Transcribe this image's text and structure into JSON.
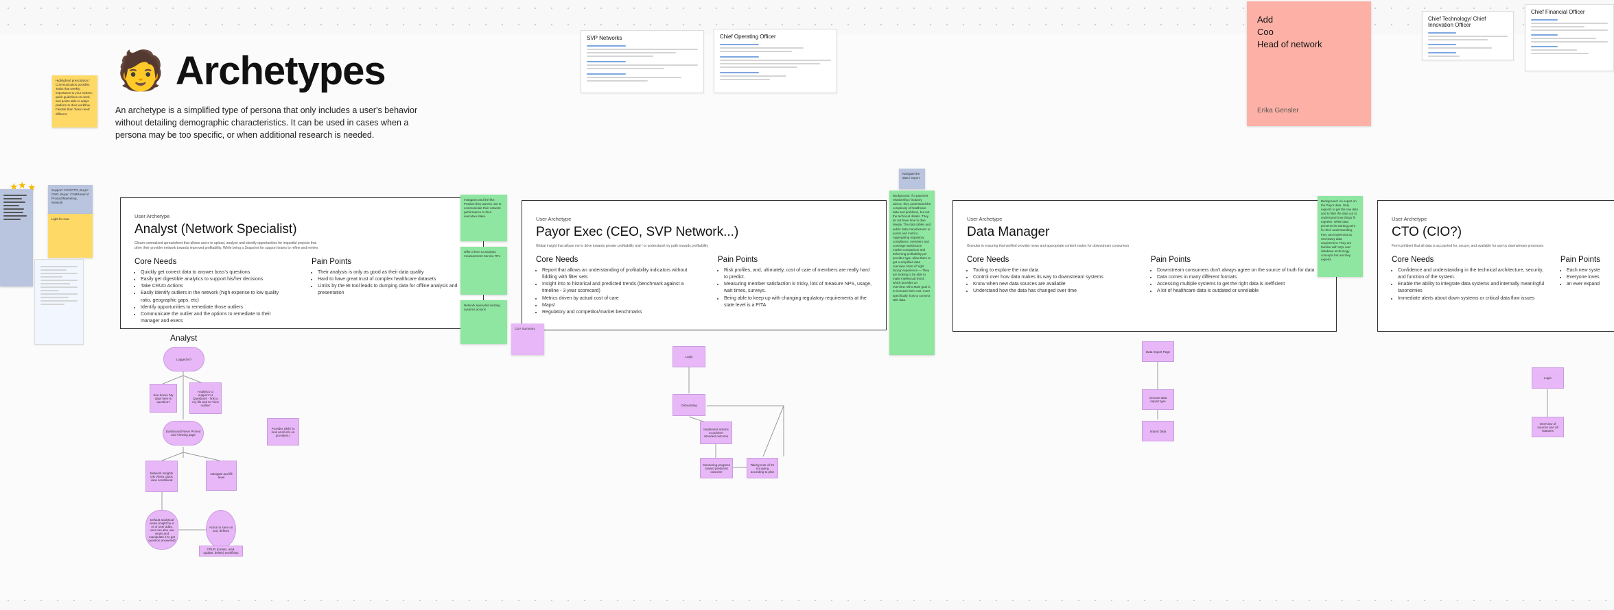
{
  "header": {
    "emoji": "🧑",
    "title": "Archetypes",
    "intro": "An archetype is a simplified type of persona that only includes a user's behavior without detailing demographic characteristics. It can be used in cases when a persona may be too specific, or when additional research is needed."
  },
  "pink_note": {
    "lines": [
      "Add",
      "Coo",
      "Head of network"
    ],
    "author": "Erika Gensler"
  },
  "docs": {
    "svp": "SVP Networks",
    "coo": "Chief Operating Officer",
    "cto": "Chief Technology/ Chief Innovation Officer",
    "cfo": "Chief Financial Officer"
  },
  "cards": [
    {
      "kicker": "User Archetype",
      "title": "Analyst (Network Specialist)",
      "desc": "Gleans centralized spreadsheet that allows users to upload, analyze and identify opportunities for impactful projects that drive their provider network towards improved profitability. While being a Snapshot for support teams to refine and review.",
      "core_title": "Core Needs",
      "core": [
        "Quickly get correct data to answer boss's questions",
        "Easily get digestible analytics to support his/her decisions",
        "Take CRUD Actions",
        "Easily identify outliers in the network (high expense to low quality ratio, geographic gaps, etc)",
        "Identify opportunities to remediate those outliers",
        "Communicate the outlier and the options to remediate to their manager and execs"
      ],
      "pain_title": "Pain Points",
      "pain": [
        "Their analysis is only as good as their data quality",
        "Hard to have great trust of complex healthcare datasets",
        "Limits by the BI tool leads to dumping data for offline analysis and presentation"
      ]
    },
    {
      "kicker": "User Archetype",
      "title": "Payor Exec (CEO, SVP Network...)",
      "desc": "Global insight that allows me to drive towards greater profitability and / or understand my path towards profitability",
      "core_title": "Core Needs",
      "core": [
        "Report that allows an understanding of profitability indicators without fiddling with filter sets",
        "Insight into to historical and predicted trends (benchmark against a timeline - 3 year scorecard)",
        "Metrics driven by actual cost of care",
        "Maps!",
        "Regulatory and competitor/market benchmarks"
      ],
      "pain_title": "Pain Points",
      "pain": [
        "Risk profiles, and, ultimately, cost of care of members are really hard to predict.",
        "Measuring member satisfaction is tricky, lots of measure NPS, usage, wait times, surveys.",
        "Being able to keep up with changing regulatory requirements at the state level is a PITA"
      ]
    },
    {
      "kicker": "User Archetype",
      "title": "Data Manager",
      "desc": "Granular in ensuring that verified provider news and appropriate content routes for downstream consumers",
      "core_title": "Core Needs",
      "core": [
        "Tooling to explore the raw data",
        "Control over how data makes its way to downstream systems",
        "Know when new data sources are available",
        "Understand how the data has changed over time"
      ],
      "pain_title": "Pain Points",
      "pain": [
        "Downstream consumers don't always agree on the source of truth for data",
        "Data comes in many different formats",
        "Accessing multiple systems to get the right data is inefficient",
        "A lot of healthcare data is outdated or unreliable"
      ]
    },
    {
      "kicker": "User Archetype",
      "title": "CTO (CIO?)",
      "desc": "Feel confident that all data is accounted for, secure, and available for use by downstream processes",
      "core_title": "Core Needs",
      "core": [
        "Confidence and understanding in the technical architecture, security, and function of the system.",
        "Enable the ability to integrate data systems and internally meaningful taxonomies",
        "Immediate alerts about down systems or critical data flow issues"
      ],
      "pain_title": "Pain Points",
      "pain": [
        "Each new syste",
        "Everyone loves",
        "an ever expand"
      ]
    }
  ],
  "flow": {
    "analyst_label": "Analyst",
    "a_start": "Logged in?",
    "a_q1": "See boxes 'My data' here in question?",
    "a_q2": "Analytics to support 'AI Questions' - link to my file and to 'View outline'",
    "a_dash": "Dashboard/Views Pinned and Viewing page",
    "a_insight": "Network Insights OR Views Quick view conditional",
    "a_navigate": "Navigate and fill level",
    "a_export": "Default analytical views (might be in AI or user adds, user can also use views and manipulate it to get question answered)",
    "a_action": "Action to save on tool, defines",
    "a_crud": "CRUD (create, read, update, delete) workflows",
    "a_side": "Provider Skill / to look at all info on providers )",
    "p_login": "Login",
    "p_onboard": "Onboarding",
    "p_impl": "Implement actions to achieve intended outcome",
    "p_monitor": "Monitoring progress toward predicted outcome",
    "p_track": "Taking note of it's not going according to plan",
    "d_import": "Data Import Page",
    "d_choose": "Choose data import type",
    "d_report": "Import Data",
    "c_login": "Login",
    "c_overview": "Overview of sources and all statuses"
  },
  "stickies": {
    "yellow_top": "Highlighted prescription / Communication possible. Tasks that weekly: importance to your system, quick guidelines on need and points able to adapt platform to their workflow. Flexible than 'basic need' different",
    "yellow_side": "Support: CSO/CTO, Buyer: CMO, Buyer: CDM/Head of Product/Marketing, Network",
    "yellow_side2": "Light for now",
    "green_1": "Instagram and the like: Product they want to use to communicate their network performance to their executive stake.",
    "green_2": "Offer a form to analysts measurement Service RFx",
    "green_3": "Network specialist existing systems actions",
    "green_big": "Background: If a payment relationship / industry advice, they understand the complexity of healthcare data and problems, but not the technical details. They do not have time to dive deeply. The data tables and public data manufacturer or points and metrics. Aggregating regulatory compliance, members and coverage satisfaction market comparison and delivering profitability per provider type, allow them to get a simplified data overview. Most of 'right facing' experience — They are looking to be able to make intellectual trend, which provides an overview. Who Main goal is to increase their cost, more specifically, how to connect with data.",
    "green_dm": "Background: An expert on the Payor data. Only expects to get the raw data and to filter the data out to understand how things fit together. While data presents its starting point for their understanding, they can implement as necessary data requirement. They are familiar with SQL and database technology concepts but are they experts.",
    "pink_small": "CSV Summary",
    "blue_small": "Navigate the data / export"
  }
}
